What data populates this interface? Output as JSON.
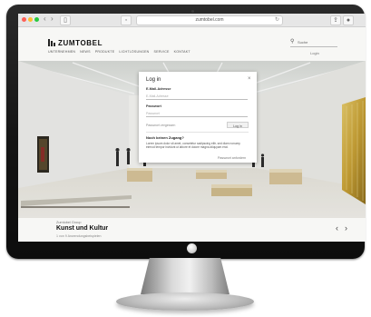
{
  "browser": {
    "url": "zumtobel.com"
  },
  "site": {
    "brand": "ZUMTOBEL",
    "nav": [
      "UNTERNEHMEN",
      "NEWS",
      "PRODUKTE",
      "LICHTLÖSUNGEN",
      "SERVICE",
      "KONTAKT"
    ],
    "search_label": "Suche",
    "login_link": "Login"
  },
  "login_dialog": {
    "title": "Log in",
    "close_glyph": "×",
    "email_label": "E-Mail-Adresse",
    "email_placeholder": "E-Mail-Adresse",
    "password_label": "Passwort",
    "password_placeholder": "Passwort",
    "forgot_link": "Passwort vergessen",
    "submit_label": "Log in",
    "no_account_heading": "Noch keinen Zugang?",
    "register_copy": "Lorem ipsum dolor sit amet, consetetur sadipscing elitr, sed diam nonumy eirmod tempor invidunt ut labore et dolore magna aliquyam erat.",
    "register_link": "Passwort anfordern"
  },
  "caption": {
    "eyebrow": "Zumtobel Group",
    "title": "Kunst und Kultur",
    "meta": "1 von 9 Anwendungsbeispielen",
    "prev_glyph": "‹",
    "next_glyph": "›"
  },
  "colors": {
    "gold_artwork": "#d2b14c",
    "dark_artwork": "#2f2b22"
  }
}
